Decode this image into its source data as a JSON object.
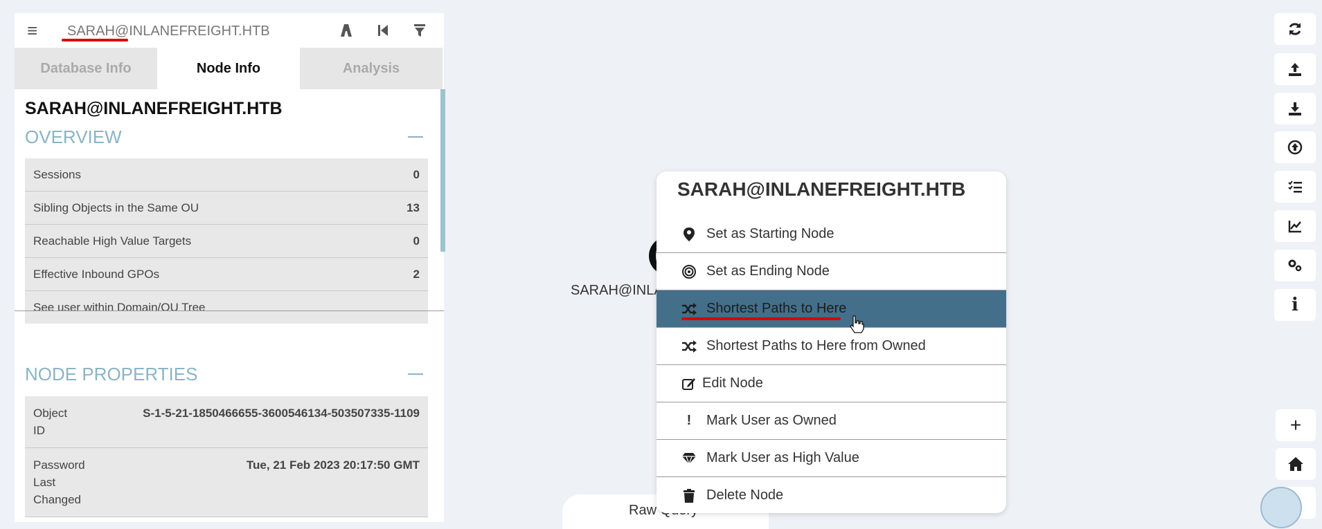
{
  "graph": {
    "node_label": "SARAH@INLANEFREIGHT.HTB",
    "raw_query_label": "Raw Query"
  },
  "search": {
    "value": "SARAH@INLANEFREIGHT.HTB",
    "icons": [
      "menu-icon",
      "pathfinding-icon",
      "back-icon",
      "filter-icon"
    ]
  },
  "tabs": [
    "Database Info",
    "Node Info",
    "Analysis"
  ],
  "node_info": {
    "title": "SARAH@INLANEFREIGHT.HTB",
    "overview_heading": "OVERVIEW",
    "overview_rows": [
      {
        "label": "Sessions",
        "value": "0"
      },
      {
        "label": "Sibling Objects in the Same OU",
        "value": "13"
      },
      {
        "label": "Reachable High Value Targets",
        "value": "0"
      },
      {
        "label": "Effective Inbound GPOs",
        "value": "2"
      },
      {
        "label": "See user within Domain/OU Tree",
        "value": ""
      }
    ],
    "properties_heading": "NODE PROPERTIES",
    "properties": [
      {
        "key": "Object ID",
        "value": "S-1-5-21-1850466655-3600546134-503507335-1109"
      },
      {
        "key": "Password Last Changed",
        "value": "Tue, 21 Feb 2023 20:17:50 GMT"
      }
    ]
  },
  "context_menu": {
    "title": "SARAH@INLANEFREIGHT.HTB",
    "items": [
      {
        "label": "Set as Starting Node",
        "icon": "map-marker-icon"
      },
      {
        "label": "Set as Ending Node",
        "icon": "bullseye-icon"
      },
      {
        "label": "Shortest Paths to Here",
        "icon": "random-icon"
      },
      {
        "label": "Shortest Paths to Here from Owned",
        "icon": "random-icon"
      },
      {
        "label": "Edit Node",
        "icon": "edit-icon"
      },
      {
        "label": "Mark User as Owned",
        "icon": "exclamation-icon"
      },
      {
        "label": "Mark User as High Value",
        "icon": "gem-icon"
      },
      {
        "label": "Delete Node",
        "icon": "trash-icon"
      }
    ],
    "highlighted_item": "Shortest Paths to Here"
  },
  "right_toolbar": [
    "refresh-icon",
    "upload-icon",
    "download-icon",
    "import-icon",
    "query-list-icon",
    "chart-icon",
    "settings-icon",
    "info-icon"
  ],
  "zoom_controls": [
    "zoom-in-icon",
    "home-icon",
    "zoom-out-icon"
  ],
  "colors": {
    "accent": "#8ab4c4",
    "highlight": "#436f8a",
    "annotation": "#dd0000"
  }
}
